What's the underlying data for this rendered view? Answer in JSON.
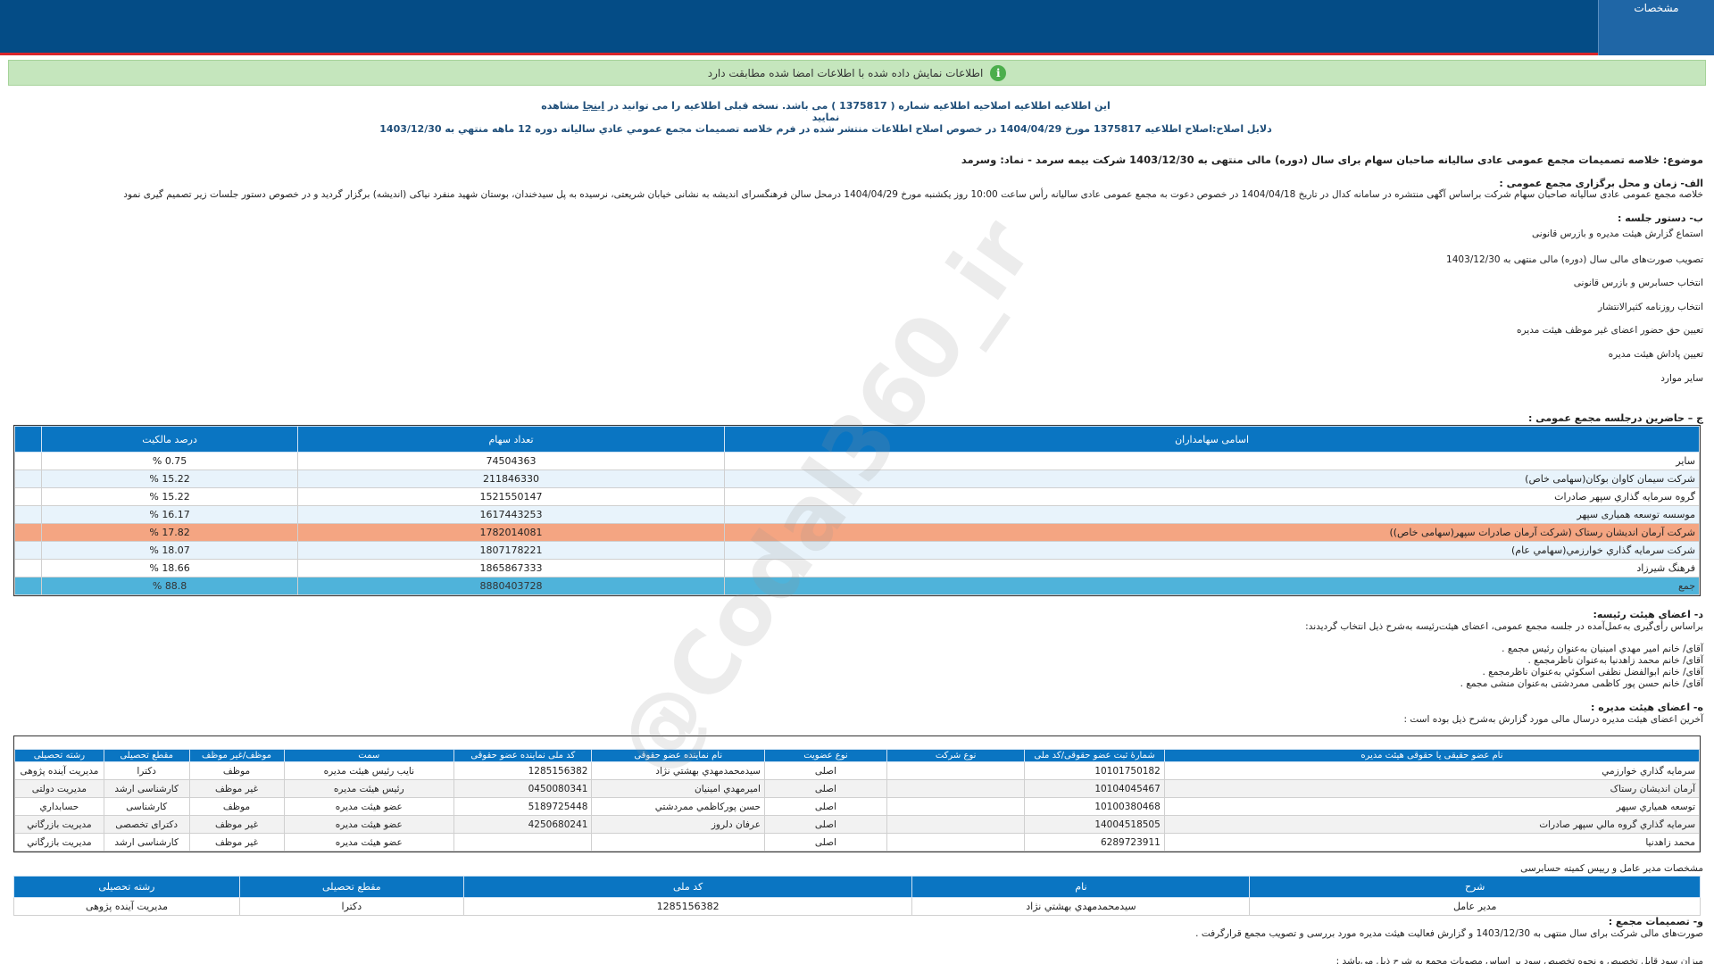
{
  "header": {
    "tab_label": "مشخصات"
  },
  "verify": {
    "message": "اطلاعات نمایش داده شده با اطلاعات امضا شده مطابقت دارد"
  },
  "notice": {
    "amendment_text": "این اطلاعیه اطلاعیه اصلاحیه اطلاعیه شماره ( 1375817 ) می باشد. نسخه قبلی اطلاعیه را می توانید در",
    "link_text": "اینجا",
    "amendment_suffix": "مشاهده نمایید",
    "reason": "دلایل اصلاح:اصلاح اطلاعیه 1375817 مورخ 1404/04/29 در خصوص اصلاح اطلاعات منتشر شده در فرم خلاصه تصمیمات مجمع عمومي عادي ساليانه دوره 12 ماهه منتهي به 1403/12/30"
  },
  "subject": "موضوع: خلاصه تصمیمات مجمع عمومی عادی سالیانه صاحبان سهام برای سال (دوره) مالی منتهی به 1403/12/30 شرکت بیمه سرمد - نماد: وسرمد",
  "section_a": {
    "heading": "الف- زمان و محل برگزاری مجمع عمومی :",
    "body": "خلاصه مجمع عمومی عادی سالیانه صاحبان سهام شرکت براساس آگهی منتشره در سامانه کدال در تاریخ 1404/04/18 در خصوص دعوت به مجمع عمومی عادی سالیانه رأس ساعت 10:00 روز یکشنبه مورخ 1404/04/29 درمحل  سالن فرهنگسرای اندیشه به نشانی خیابان شریعتی، نرسیده به پل سیدخندان، بوستان شهید منفرد نیاکی (اندیشه)   برگزار گردید و در خصوص دستور جلسات زیر تصمیم گیری نمود"
  },
  "section_b": {
    "heading": "ب- دستور جلسه :",
    "items": [
      "استماع گزارش هیئت مدیره و بازرس قانونی",
      "تصویب صورت‌های مالی سال (دوره) مالی منتهی به 1403/12/30",
      "انتخاب حسابرس و بازرس قانونی",
      "انتخاب روزنامه کثیرالانتشار",
      "تعیین حق حضور اعضای غیر موظف هیئت مدیره",
      "تعیین پاداش هیئت مدیره",
      "سایر موارد"
    ]
  },
  "section_c": {
    "heading": "ج – حاضرین درجلسه مجمع عمومی :",
    "columns": [
      "اسامی سهامداران",
      "تعداد سهام",
      "درصد مالکیت"
    ],
    "rows": [
      {
        "name": "سایر",
        "shares": "74504363",
        "percent": "0.75 %"
      },
      {
        "name": "شرکت سیمان کاوان بوکان(سهامی خاص)",
        "shares": "211846330",
        "percent": "15.22 %"
      },
      {
        "name": "گروه سرمايه گذاري سپهر صادرات",
        "shares": "1521550147",
        "percent": "15.22 %"
      },
      {
        "name": "موسسه توسعه همیاری سپهر",
        "shares": "1617443253",
        "percent": "16.17 %"
      },
      {
        "name": "شرکت آرمان اندیشان رستاک (شرکت آرمان صادرات سپهر(سهامی خاص))",
        "shares": "1782014081",
        "percent": "17.82 %"
      },
      {
        "name": "شرکت سرمايه گذاري خوارزمي(سهامي عام)",
        "shares": "1807178221",
        "percent": "18.07 %"
      },
      {
        "name": "فرهنگ شیرزاد",
        "shares": "1865867333",
        "percent": "18.66 %"
      }
    ],
    "total": {
      "name": "جمع",
      "shares": "8880403728",
      "percent": "88.8 %"
    }
  },
  "section_d": {
    "heading": "د- اعضای هیئت رئیسه:",
    "intro": "براساس رأی‌گیری به‌عمل‌آمده در جلسه مجمع عمومی، اعضای هیئت‌رئیسه به‌شرح ذیل انتخاب گردیدند:",
    "lines": [
      "آقای/ خانم   امیر مهدي امینیان   به‌عنوان رئیس مجمع .",
      "آقای/ خانم   محمد زاهدنیا   به‌عنوان ناظرمجمع .",
      "آقای/ خانم   ابوالفضل نظفی اسکوئي   به‌عنوان ناظرمجمع .",
      "آقای/ خانم   حسن پور کاظمی ممردشتی   به‌عنوان منشی مجمع ."
    ]
  },
  "section_e": {
    "heading": "ه- اعضای هیئت مدیره :",
    "intro": "آخرین اعضای هیئت مدیره درسال مالی مورد گزارش به‌شرح ذیل بوده است :",
    "columns": [
      "نام عضو حقیقی یا حقوقی هیئت مدیره",
      "شمارۀ ثبت عضو حقوقی/کد ملی",
      "نوع شرکت",
      "نوع عضویت",
      "نام نماینده عضو حقوقی",
      "کد ملی نماینده عضو حقوقی",
      "سمت",
      "موظف/غیر موظف",
      "مقطع تحصیلی",
      "رشته تحصیلی"
    ],
    "rows": [
      [
        "سرمايه گذاري خوارزمي",
        "10101750182",
        "",
        "اصلی",
        "سيدمحمدمهدي بهشتي نژاد",
        "1285156382",
        "نایب رئیس هیئت مدیره",
        "موظف",
        "دکترا",
        "مدیریت آینده پژوهی"
      ],
      [
        "آرمان انديشان رستاک",
        "10104045467",
        "",
        "اصلی",
        "اميرمهدي امينيان",
        "0450080341",
        "رئیس هیئت مدیره",
        "غیر موظف",
        "کارشناسی ارشد",
        "مدیریت دولتی"
      ],
      [
        "توسعه همياري سپهر",
        "10100380468",
        "",
        "اصلی",
        "حسن پورکاظمي ممردشتي",
        "5189725448",
        "عضو هیئت مدیره",
        "موظف",
        "کارشناسی",
        "حسابداري"
      ],
      [
        "سرمايه گذاري گروه مالي سپهر صادرات",
        "14004518505",
        "",
        "اصلی",
        "عرفان دلروز",
        "4250680241",
        "عضو هیئت مدیره",
        "غیر موظف",
        "دکترای تخصصی",
        "مديريت بازرگاني"
      ],
      [
        "محمد زاهدنيا",
        "6289723911",
        "",
        "اصلی",
        "",
        "",
        "عضو هیئت مدیره",
        "غیر موظف",
        "کارشناسی ارشد",
        "مديريت بازرگاني"
      ]
    ]
  },
  "section_ceo": {
    "heading": "مشخصات مدیر عامل و رییس کمیته حسابرسی",
    "columns": [
      "شرح",
      "نام",
      "کد ملی",
      "مقطع تحصیلی",
      "رشته تحصیلی"
    ],
    "row": [
      "مدیر عامل",
      "سيدمحمدمهدي بهشتي نژاد",
      "1285156382",
      "دکترا",
      "مدیریت آینده پژوهی"
    ]
  },
  "section_f": {
    "heading": "و- تصمیمات مجمع :",
    "line1": "صورت‌های مالی شرکت برای سال منتهی به  1403/12/30 و گزارش فعالیت هیئت مدیره مورد بررسی و تصویب مجمع قرارگرفت .",
    "line2": "میزان سود قابل تخصیص و نحوه تخصیص سود بر اساس مصوبات مجمع به شرح ذیل می‌باشد :"
  },
  "watermark": "@Codal360_ir"
}
